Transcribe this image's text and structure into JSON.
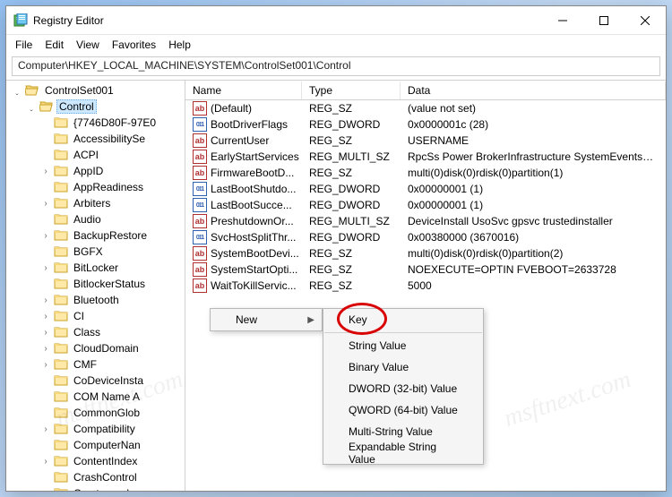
{
  "window": {
    "title": "Registry Editor"
  },
  "menu": {
    "file": "File",
    "edit": "Edit",
    "view": "View",
    "favorites": "Favorites",
    "help": "Help"
  },
  "address": "Computer\\HKEY_LOCAL_MACHINE\\SYSTEM\\ControlSet001\\Control",
  "tree": {
    "top": [
      {
        "label": "ControlSet001",
        "level": 0,
        "exp": true,
        "open": true
      },
      {
        "label": "Control",
        "level": 1,
        "exp": true,
        "open": true,
        "sel": true
      }
    ],
    "children": [
      {
        "label": "{7746D80F-97E0"
      },
      {
        "label": "AccessibilitySe"
      },
      {
        "label": "ACPI"
      },
      {
        "label": "AppID",
        "exp": true
      },
      {
        "label": "AppReadiness"
      },
      {
        "label": "Arbiters",
        "exp": true
      },
      {
        "label": "Audio"
      },
      {
        "label": "BackupRestore",
        "exp": true
      },
      {
        "label": "BGFX"
      },
      {
        "label": "BitLocker",
        "exp": true
      },
      {
        "label": "BitlockerStatus"
      },
      {
        "label": "Bluetooth",
        "exp": true
      },
      {
        "label": "CI",
        "exp": true
      },
      {
        "label": "Class",
        "exp": true
      },
      {
        "label": "CloudDomain",
        "exp": true
      },
      {
        "label": "CMF",
        "exp": true
      },
      {
        "label": "CoDeviceInsta"
      },
      {
        "label": "COM Name A"
      },
      {
        "label": "CommonGlob"
      },
      {
        "label": "Compatibility",
        "exp": true
      },
      {
        "label": "ComputerNan"
      },
      {
        "label": "ContentIndex",
        "exp": true
      },
      {
        "label": "CrashControl"
      },
      {
        "label": "Cryptography",
        "exp": true
      }
    ]
  },
  "columns": {
    "name": "Name",
    "type": "Type",
    "data": "Data"
  },
  "values": [
    {
      "icon": "str",
      "name": "(Default)",
      "type": "REG_SZ",
      "data": "(value not set)"
    },
    {
      "icon": "bin",
      "name": "BootDriverFlags",
      "type": "REG_DWORD",
      "data": "0x0000001c (28)"
    },
    {
      "icon": "str",
      "name": "CurrentUser",
      "type": "REG_SZ",
      "data": "USERNAME"
    },
    {
      "icon": "str",
      "name": "EarlyStartServices",
      "type": "REG_MULTI_SZ",
      "data": "RpcSs Power BrokerInfrastructure SystemEventsBr..."
    },
    {
      "icon": "str",
      "name": "FirmwareBootD...",
      "type": "REG_SZ",
      "data": "multi(0)disk(0)rdisk(0)partition(1)"
    },
    {
      "icon": "bin",
      "name": "LastBootShutdo...",
      "type": "REG_DWORD",
      "data": "0x00000001 (1)"
    },
    {
      "icon": "bin",
      "name": "LastBootSucce...",
      "type": "REG_DWORD",
      "data": "0x00000001 (1)"
    },
    {
      "icon": "str",
      "name": "PreshutdownOr...",
      "type": "REG_MULTI_SZ",
      "data": "DeviceInstall UsoSvc gpsvc trustedinstaller"
    },
    {
      "icon": "bin",
      "name": "SvcHostSplitThr...",
      "type": "REG_DWORD",
      "data": "0x00380000 (3670016)"
    },
    {
      "icon": "str",
      "name": "SystemBootDevi...",
      "type": "REG_SZ",
      "data": "multi(0)disk(0)rdisk(0)partition(2)"
    },
    {
      "icon": "str",
      "name": "SystemStartOpti...",
      "type": "REG_SZ",
      "data": " NOEXECUTE=OPTIN  FVEBOOT=2633728"
    },
    {
      "icon": "str",
      "name": "WaitToKillServic...",
      "type": "REG_SZ",
      "data": "5000"
    }
  ],
  "context": {
    "new": "New",
    "sub": {
      "key": "Key",
      "string": "String Value",
      "binary": "Binary Value",
      "dword": "DWORD (32-bit) Value",
      "qword": "QWORD (64-bit) Value",
      "multi": "Multi-String Value",
      "expand": "Expandable String Value"
    }
  },
  "watermark": "msftnext.com"
}
